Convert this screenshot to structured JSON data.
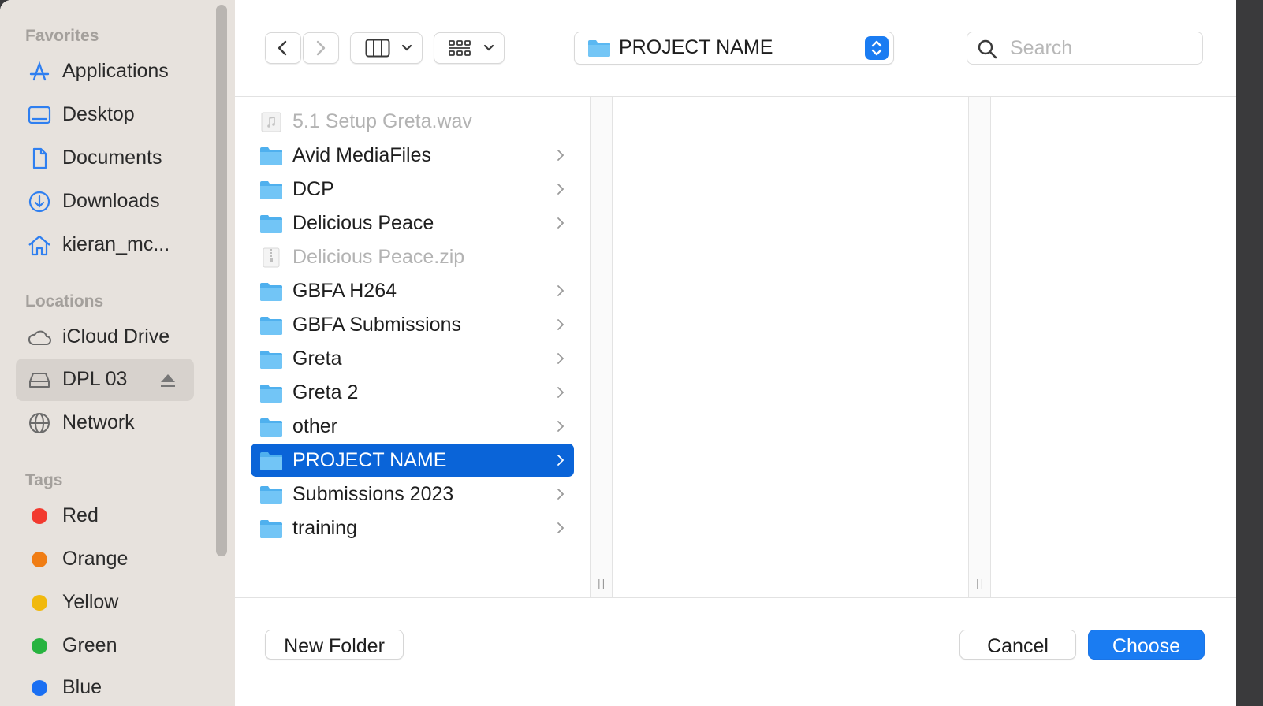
{
  "sidebar": {
    "favorites_heading": "Favorites",
    "favorites": [
      {
        "label": "Applications",
        "icon": "applications-icon"
      },
      {
        "label": "Desktop",
        "icon": "desktop-icon"
      },
      {
        "label": "Documents",
        "icon": "document-icon"
      },
      {
        "label": "Downloads",
        "icon": "download-icon"
      },
      {
        "label": "kieran_mc...",
        "icon": "home-icon"
      }
    ],
    "locations_heading": "Locations",
    "locations": [
      {
        "label": "iCloud Drive",
        "icon": "cloud-icon"
      },
      {
        "label": "DPL 03",
        "icon": "drive-icon",
        "selected": true
      },
      {
        "label": "Network",
        "icon": "globe-icon"
      }
    ],
    "tags_heading": "Tags",
    "tags": [
      {
        "label": "Red",
        "color": "#f23a2f"
      },
      {
        "label": "Orange",
        "color": "#f07d14"
      },
      {
        "label": "Yellow",
        "color": "#f1b90d"
      },
      {
        "label": "Green",
        "color": "#27b33f"
      },
      {
        "label": "Blue",
        "color": "#1a6ff2"
      }
    ]
  },
  "toolbar": {
    "path_label": "PROJECT NAME",
    "search_placeholder": "Search"
  },
  "browser": {
    "items": [
      {
        "label": "5.1 Setup Greta.wav",
        "kind": "audio-file",
        "disabled": true
      },
      {
        "label": "Avid MediaFiles",
        "kind": "folder"
      },
      {
        "label": "DCP",
        "kind": "folder"
      },
      {
        "label": "Delicious Peace",
        "kind": "folder"
      },
      {
        "label": "Delicious Peace.zip",
        "kind": "zip-file",
        "disabled": true
      },
      {
        "label": "GBFA H264",
        "kind": "folder"
      },
      {
        "label": "GBFA Submissions",
        "kind": "folder"
      },
      {
        "label": "Greta",
        "kind": "folder"
      },
      {
        "label": "Greta 2",
        "kind": "folder"
      },
      {
        "label": "other",
        "kind": "folder"
      },
      {
        "label": "PROJECT NAME",
        "kind": "folder",
        "selected": true
      },
      {
        "label": "Submissions 2023",
        "kind": "folder"
      },
      {
        "label": "training",
        "kind": "folder"
      }
    ]
  },
  "footer": {
    "new_folder": "New Folder",
    "cancel": "Cancel",
    "choose": "Choose"
  },
  "colors": {
    "accent": "#1a7cf2",
    "selection": "#0a64d8",
    "folder": "#5ab8f2",
    "sidebar_icon": "#2f7ff0"
  }
}
